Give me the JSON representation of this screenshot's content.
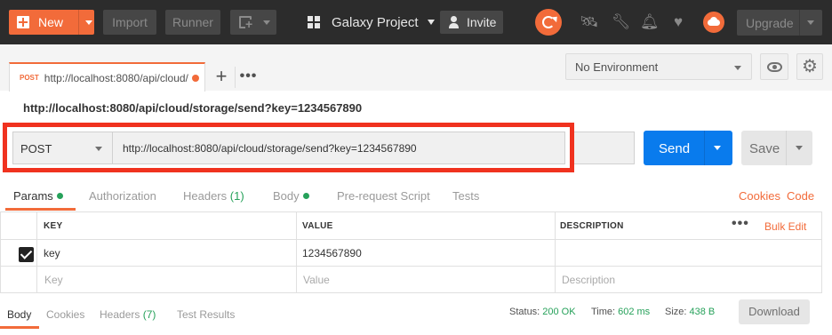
{
  "colors": {
    "accent": "#f26b3a",
    "send_blue": "#097bed",
    "success_green": "#26a15a",
    "highlight_red": "#f0321f"
  },
  "topbar": {
    "new_label": "New",
    "import_label": "Import",
    "runner_label": "Runner",
    "workspace_name": "Galaxy Project",
    "invite_label": "Invite",
    "upgrade_label": "Upgrade",
    "icons": [
      "sync-icon",
      "satellite-icon",
      "wrench-icon",
      "bell-icon",
      "heart-icon",
      "avatar-cloud-icon"
    ]
  },
  "tab": {
    "method": "POST",
    "url": "http://localhost:8080/api/cloud/storage/send?key=1234567890"
  },
  "environment": {
    "selected": "No Environment"
  },
  "request": {
    "title": "http://localhost:8080/api/cloud/storage/send?key=1234567890",
    "method": "POST",
    "url": "http://localhost:8080/api/cloud/storage/send?key=1234567890",
    "send_label": "Send",
    "save_label": "Save"
  },
  "request_tabs": {
    "params": "Params",
    "authorization": "Authorization",
    "headers": "Headers",
    "headers_count": "(1)",
    "body": "Body",
    "prerequest": "Pre-request Script",
    "tests": "Tests",
    "cookies": "Cookies",
    "code": "Code"
  },
  "params_table": {
    "headers": {
      "key": "KEY",
      "value": "VALUE",
      "description": "DESCRIPTION"
    },
    "bulk_edit": "Bulk Edit",
    "rows": [
      {
        "key": "key",
        "value": "1234567890",
        "description": ""
      }
    ],
    "placeholders": {
      "key": "Key",
      "value": "Value",
      "description": "Description"
    }
  },
  "response": {
    "tabs": {
      "body": "Body",
      "cookies": "Cookies",
      "headers": "Headers",
      "headers_count": "(7)",
      "test_results": "Test Results"
    },
    "status_label": "Status:",
    "status_value": "200 OK",
    "time_label": "Time:",
    "time_value": "602 ms",
    "size_label": "Size:",
    "size_value": "438 B",
    "download_label": "Download"
  }
}
